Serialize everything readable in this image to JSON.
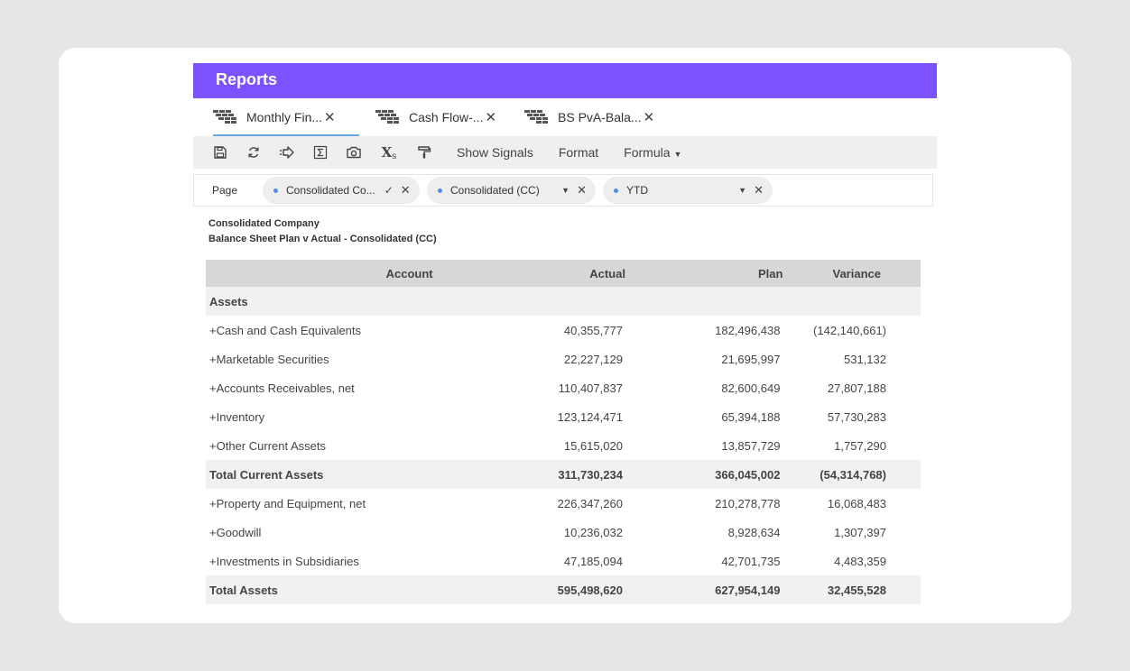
{
  "app": {
    "title": "Reports"
  },
  "tabs": [
    {
      "label": "Monthly Fin...",
      "icon": "report-grid-icon"
    },
    {
      "label": "Cash Flow-...",
      "icon": "report-grid-icon"
    },
    {
      "label": "BS PvA-Bala...",
      "icon": "report-grid-icon"
    }
  ],
  "toolbar": {
    "icons": [
      "save-icon",
      "refresh-icon",
      "export-icon",
      "sum-icon",
      "camera-icon",
      "subscript-icon",
      "paint-roller-icon"
    ],
    "subscript_glyph": "X",
    "subscript_sub": "s",
    "show_signals": "Show Signals",
    "format": "Format",
    "formula": "Formula"
  },
  "page_filter": {
    "label": "Page",
    "chips": [
      {
        "value": "Consolidated Co..."
      },
      {
        "value": "Consolidated (CC)"
      },
      {
        "value": "YTD"
      }
    ]
  },
  "report": {
    "company": "Consolidated Company",
    "subtitle": "Balance Sheet Plan v Actual - Consolidated (CC)",
    "columns": {
      "account": "Account",
      "actual": "Actual",
      "plan": "Plan",
      "variance": "Variance"
    },
    "rows": [
      {
        "account": "Assets",
        "actual": "",
        "plan": "",
        "variance": "",
        "kind": "section"
      },
      {
        "account": "+Cash and Cash Equivalents",
        "actual": "40,355,777",
        "plan": "182,496,438",
        "variance": "(142,140,661)"
      },
      {
        "account": "+Marketable Securities",
        "actual": "22,227,129",
        "plan": "21,695,997",
        "variance": "531,132"
      },
      {
        "account": "+Accounts Receivables, net",
        "actual": "110,407,837",
        "plan": "82,600,649",
        "variance": "27,807,188"
      },
      {
        "account": "+Inventory",
        "actual": "123,124,471",
        "plan": "65,394,188",
        "variance": "57,730,283"
      },
      {
        "account": "+Other Current Assets",
        "actual": "15,615,020",
        "plan": "13,857,729",
        "variance": "1,757,290"
      },
      {
        "account": "Total Current Assets",
        "actual": "311,730,234",
        "plan": "366,045,002",
        "variance": "(54,314,768)",
        "kind": "total"
      },
      {
        "account": "+Property and Equipment, net",
        "actual": "226,347,260",
        "plan": "210,278,778",
        "variance": "16,068,483"
      },
      {
        "account": "+Goodwill",
        "actual": "10,236,032",
        "plan": "8,928,634",
        "variance": "1,307,397"
      },
      {
        "account": "+Investments in Subsidiaries",
        "actual": "47,185,094",
        "plan": "42,701,735",
        "variance": "4,483,359"
      },
      {
        "account": "Total Assets",
        "actual": "595,498,620",
        "plan": "627,954,149",
        "variance": "32,455,528",
        "kind": "total"
      }
    ]
  },
  "colors": {
    "header": "#7c53ff",
    "tab_underline": "#6aa7e8",
    "chip_dot": "#4f8ee8"
  }
}
